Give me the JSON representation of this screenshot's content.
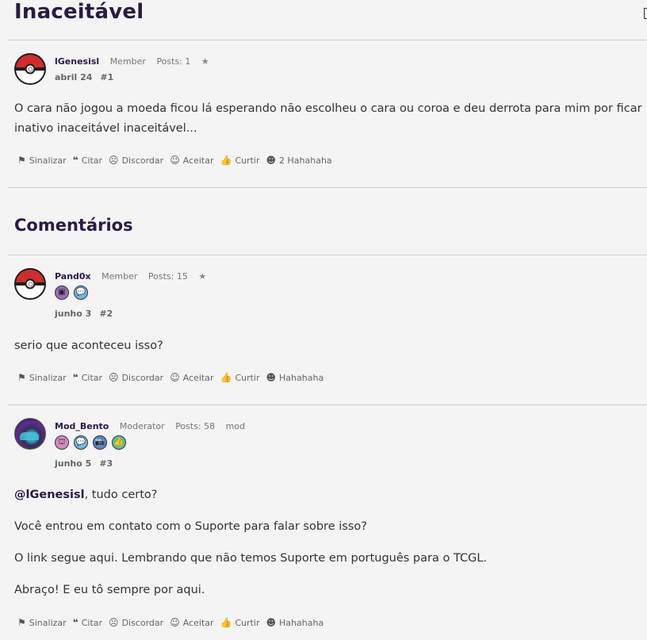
{
  "discussion": {
    "title": "Inaceitável"
  },
  "original_post": {
    "username": "lGenesisl",
    "role": "Member",
    "posts": "Posts: 1",
    "star": "★",
    "date": "abril 24",
    "number": "#1",
    "body": "O cara não jogou a moeda ficou lá esperando não escolheu o cara ou coroa e deu derrota para mim por ficar inativo inaceitável inaceitável..."
  },
  "comments_heading": "Comentários",
  "actions": {
    "flag": "Sinalizar",
    "quote": "Citar",
    "disagree": "Discordar",
    "accept": "Aceitar",
    "like": "Curtir",
    "laugh_op": "2 Hahahaha",
    "laugh": "Hahahaha"
  },
  "comments": [
    {
      "username": "Pand0x",
      "role": "Member",
      "posts": "Posts: 15",
      "star": "★",
      "date": "junho 3",
      "number": "#2",
      "badges": [
        "book-badge",
        "speech-badge"
      ],
      "body": "serio que aconteceu isso?"
    },
    {
      "username": "Mod_Bento",
      "role": "Moderator",
      "posts": "Posts: 58",
      "tag": "mod",
      "date": "junho 5",
      "number": "#3",
      "badges": [
        "cake-badge",
        "speech-badge",
        "camera-badge",
        "thumbs-up-badge"
      ],
      "mention": "@lGenesisl",
      "line1_rest": ", tudo certo?",
      "line2": "Você entrou em contato com o Suporte para falar sobre isso?",
      "line3": "O link segue aqui. Lembrando que não temos Suporte em português para o TCGL.",
      "line4": "Abraço! E eu tô sempre por aqui."
    }
  ]
}
